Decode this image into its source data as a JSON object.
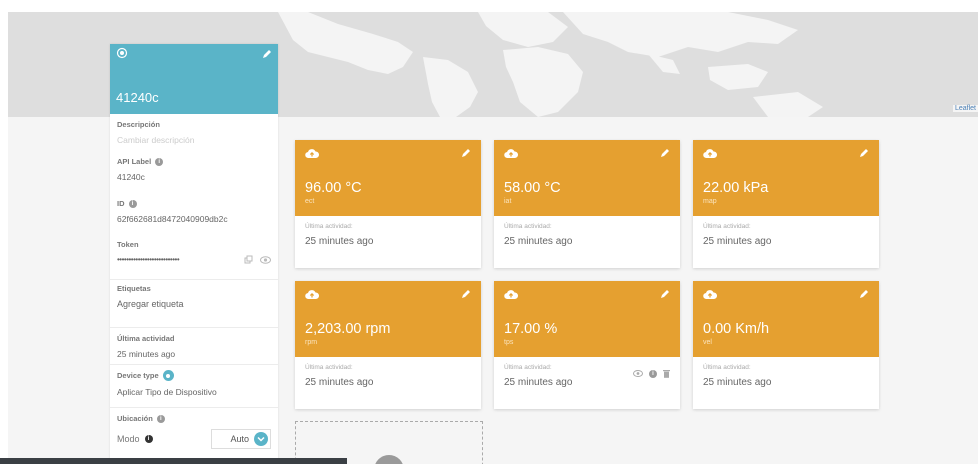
{
  "map": {
    "attribution": "Leaflet"
  },
  "device": {
    "name": "41240c",
    "description": {
      "label": "Descripción",
      "placeholder": "Cambiar descripción"
    },
    "api_label": {
      "label": "API Label",
      "value": "41240c"
    },
    "id": {
      "label": "ID",
      "value": "62f662681d8472040909db2c"
    },
    "token": {
      "label": "Token",
      "value": "•••••••••••••••••••••••••••"
    },
    "tags": {
      "label": "Etiquetas",
      "add": "Agregar etiqueta"
    },
    "last_activity": {
      "label": "Última actividad",
      "value": "25 minutes ago"
    },
    "device_type": {
      "label": "Device type",
      "value": "Aplicar Tipo de Dispositivo"
    },
    "location": {
      "label": "Ubicación"
    },
    "mode": {
      "label": "Modo",
      "value": "Auto"
    }
  },
  "cards": [
    {
      "value": "96.00 °C",
      "var": "ect",
      "ul": "Última actividad:",
      "last": "25 minutes ago"
    },
    {
      "value": "58.00 °C",
      "var": "iat",
      "ul": "Última actividad:",
      "last": "25 minutes ago"
    },
    {
      "value": "22.00 kPa",
      "var": "map",
      "ul": "Última actividad:",
      "last": "25 minutes ago"
    },
    {
      "value": "2,203.00 rpm",
      "var": "rpm",
      "ul": "Última actividad:",
      "last": "25 minutes ago"
    },
    {
      "value": "17.00 %",
      "var": "tps",
      "ul": "Última actividad:",
      "last": "25 minutes ago"
    },
    {
      "value": "0.00 Km/h",
      "var": "vel",
      "ul": "Última actividad:",
      "last": "25 minutes ago"
    }
  ],
  "colors": {
    "accent": "#5ab4c8",
    "card": "#e5a030"
  }
}
